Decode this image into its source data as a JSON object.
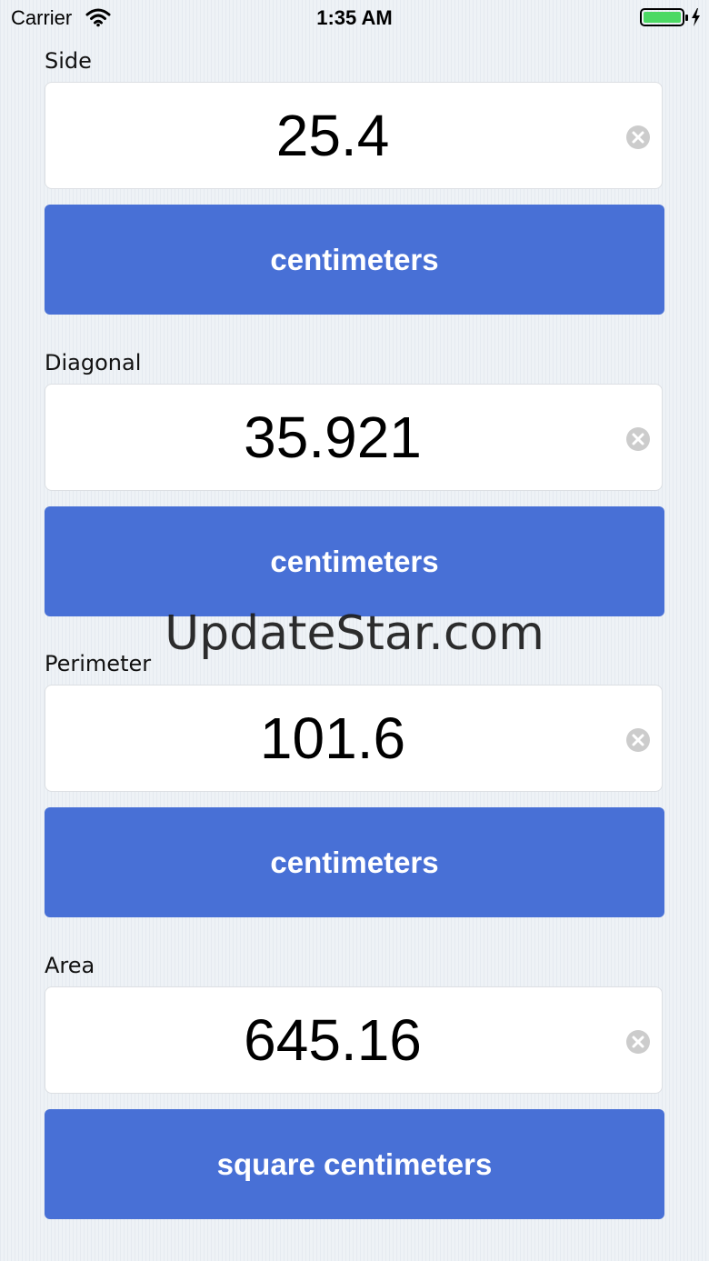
{
  "status_bar": {
    "carrier": "Carrier",
    "time": "1:35 AM",
    "wifi_icon": "wifi-icon",
    "battery_icon": "battery-charging-icon",
    "battery_color": "#4cd964"
  },
  "fields": [
    {
      "label": "Side",
      "value": "25.4",
      "unit": "centimeters"
    },
    {
      "label": "Diagonal",
      "value": "35.921",
      "unit": "centimeters"
    },
    {
      "label": "Perimeter",
      "value": "101.6",
      "unit": "centimeters"
    },
    {
      "label": "Area",
      "value": "645.16",
      "unit": "square centimeters"
    }
  ],
  "watermark": "UpdateStar.com",
  "colors": {
    "button": "#4870d6",
    "background": "#eef2f6",
    "clear_icon": "#cccccc"
  }
}
